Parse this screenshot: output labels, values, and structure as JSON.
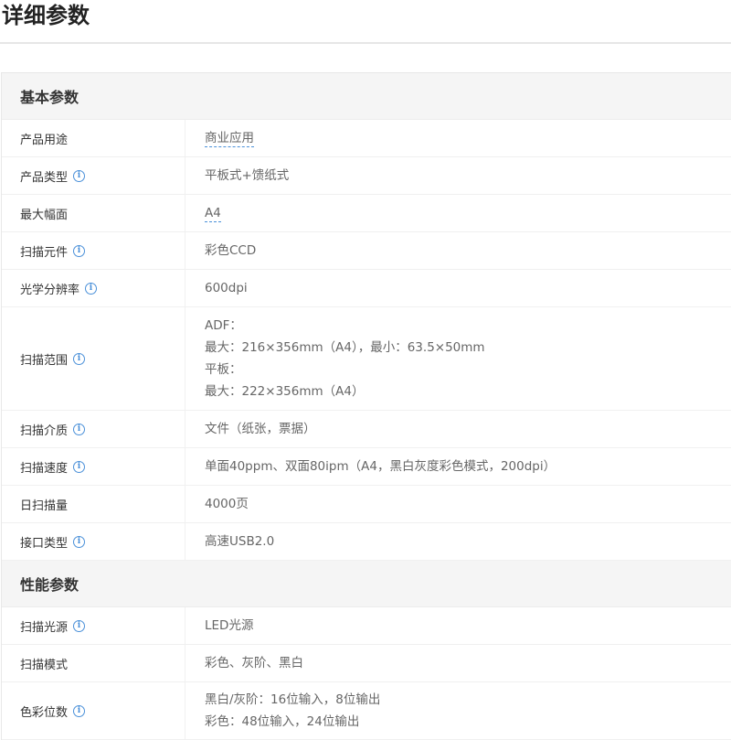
{
  "page": {
    "title": "详细参数"
  },
  "sections": [
    {
      "title": "基本参数",
      "rows": [
        {
          "label": "产品用途",
          "info": false,
          "link": true,
          "lines": [
            "商业应用"
          ]
        },
        {
          "label": "产品类型",
          "info": true,
          "link": false,
          "lines": [
            "平板式+馈纸式"
          ]
        },
        {
          "label": "最大幅面",
          "info": false,
          "link": true,
          "lines": [
            "A4"
          ]
        },
        {
          "label": "扫描元件",
          "info": true,
          "link": false,
          "lines": [
            "彩色CCD"
          ]
        },
        {
          "label": "光学分辨率",
          "info": true,
          "link": false,
          "lines": [
            "600dpi"
          ]
        },
        {
          "label": "扫描范围",
          "info": true,
          "link": false,
          "lines": [
            "ADF：",
            "最大：216×356mm（A4），最小：63.5×50mm",
            "平板：",
            "最大：222×356mm（A4）"
          ]
        },
        {
          "label": "扫描介质",
          "info": true,
          "link": false,
          "lines": [
            "文件（纸张，票据）"
          ]
        },
        {
          "label": "扫描速度",
          "info": true,
          "link": false,
          "lines": [
            "单面40ppm、双面80ipm（A4，黑白灰度彩色模式，200dpi）"
          ]
        },
        {
          "label": "日扫描量",
          "info": false,
          "link": false,
          "lines": [
            "4000页"
          ]
        },
        {
          "label": "接口类型",
          "info": true,
          "link": false,
          "lines": [
            "高速USB2.0"
          ]
        }
      ]
    },
    {
      "title": "性能参数",
      "rows": [
        {
          "label": "扫描光源",
          "info": true,
          "link": false,
          "lines": [
            "LED光源"
          ]
        },
        {
          "label": "扫描模式",
          "info": false,
          "link": false,
          "lines": [
            "彩色、灰阶、黑白"
          ]
        },
        {
          "label": "色彩位数",
          "info": true,
          "link": false,
          "lines": [
            "黑白/灰阶：16位输入，8位输出",
            "彩色：48位输入，24位输出"
          ]
        }
      ]
    }
  ],
  "icons": {
    "info": "i"
  },
  "colors": {
    "accent": "#4a90d9",
    "header_bg": "#f5f5f5"
  }
}
